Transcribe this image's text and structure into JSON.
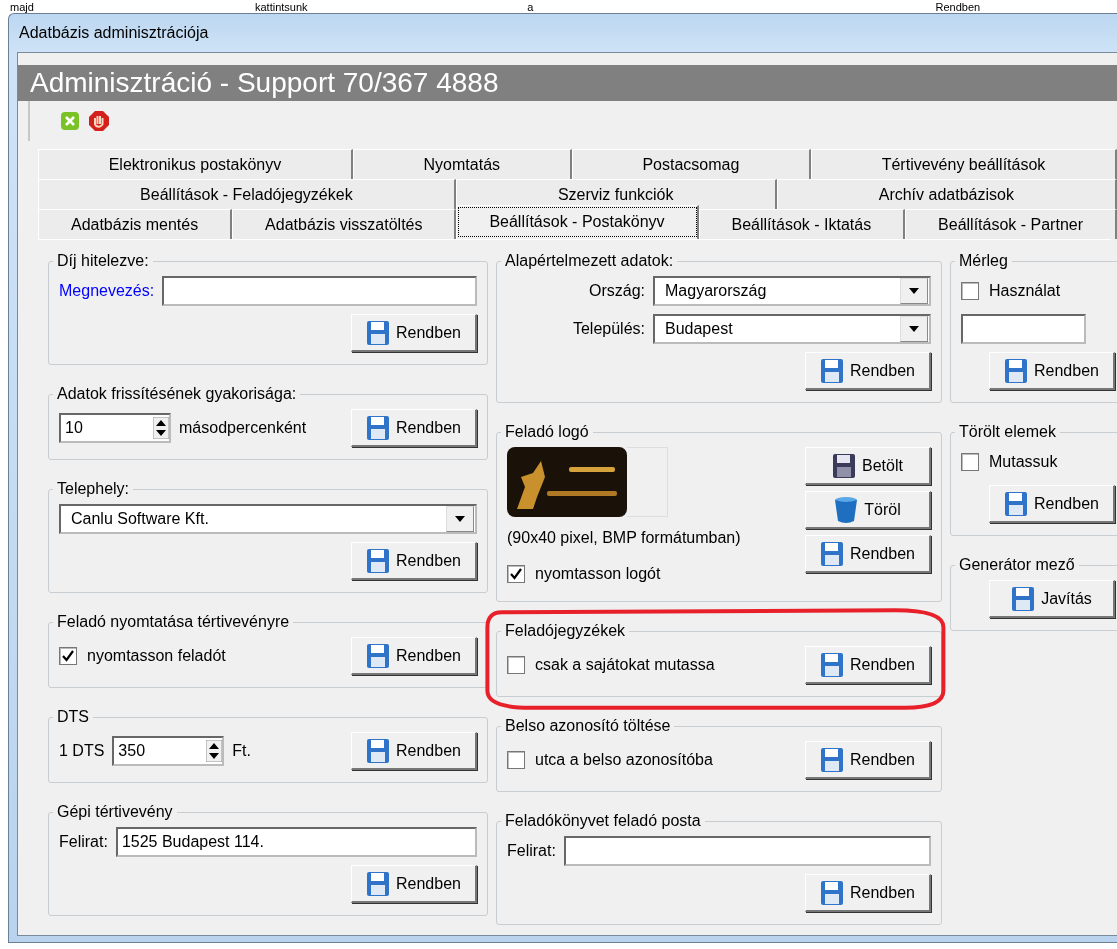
{
  "background_text": [
    "majd",
    "kattintsunk",
    "a",
    "Rendben"
  ],
  "window": {
    "title": "Adatbázis adminisztrációja"
  },
  "header": {
    "title": "Adminisztráció - Support 70/367 4888"
  },
  "toolbar": [
    {
      "kind": "ok"
    },
    {
      "kind": "stop"
    }
  ],
  "tab_rows": [
    [
      {
        "label": "Elektronikus postakönyv",
        "selected": false
      },
      {
        "label": "Nyomtatás",
        "selected": false
      },
      {
        "label": "Postacsomag",
        "selected": false
      },
      {
        "label": "Tértivevény beállítások",
        "selected": false
      }
    ],
    [
      {
        "label": "Beállítások - Feladójegyzékek",
        "selected": false
      },
      {
        "label": "Szerviz funkciók",
        "selected": false
      },
      {
        "label": "Archív adatbázisok",
        "selected": false
      }
    ],
    [
      {
        "label": "Adatbázis mentés",
        "selected": false
      },
      {
        "label": "Adatbázis visszatöltés",
        "selected": false
      },
      {
        "label": "Beállítások - Postakönyv",
        "selected": true
      },
      {
        "label": "Beállítások - Iktatás",
        "selected": false
      },
      {
        "label": "Beállítások - Partner",
        "selected": false
      }
    ]
  ],
  "columns": [
    {
      "groups": [
        {
          "title": "Díj hitelezve:",
          "kind": "stack",
          "lines": [
            [
              {
                "kind": "field",
                "label": "Megnevezés:",
                "accent": true
              }
            ],
            [
              {
                "kind": "button",
                "label": "Rendben"
              }
            ]
          ]
        },
        {
          "title": "Adatok frissítésének gyakorisága:",
          "kind": "stack",
          "lines": [
            [
              {
                "kind": "spin",
                "value": "10",
                "suffix": "másodpercenként"
              },
              {
                "kind": "button",
                "label": "Rendben"
              }
            ]
          ]
        },
        {
          "title": "Telephely:",
          "kind": "stack",
          "lines": [
            [
              {
                "kind": "combo",
                "value": "Canlu Software Kft."
              }
            ],
            [
              {
                "kind": "button",
                "label": "Rendben"
              }
            ]
          ]
        },
        {
          "title": "Feladó nyomtatása tértivevényre",
          "kind": "stack",
          "lines": [
            [
              {
                "kind": "checkbox",
                "label": "nyomtasson feladót",
                "checked": true
              },
              {
                "kind": "button",
                "label": "Rendben"
              }
            ]
          ]
        },
        {
          "title": "DTS",
          "kind": "stack",
          "lines": [
            [
              {
                "kind": "spin",
                "prefix": "1 DTS",
                "value": "350",
                "suffix": "Ft."
              },
              {
                "kind": "button",
                "label": "Rendben"
              }
            ]
          ]
        },
        {
          "title": "Gépi tértivevény",
          "kind": "stack",
          "lines": [
            [
              {
                "kind": "field",
                "label": "Felirat:",
                "value": "1525 Budapest 114."
              }
            ],
            [
              {
                "kind": "button",
                "label": "Rendben"
              }
            ]
          ]
        }
      ]
    },
    {
      "groups": [
        {
          "title": "Alapértelmezett adatok:",
          "kind": "stack",
          "lines": [
            [
              {
                "kind": "combo",
                "label": "Ország:",
                "value": "Magyarország"
              }
            ],
            [
              {
                "kind": "combo",
                "label": "Település:",
                "value": "Budapest"
              }
            ],
            [
              {
                "kind": "button",
                "label": "Rendben"
              }
            ]
          ]
        },
        {
          "title": "Feladó logó",
          "kind": "split",
          "left": [
            [
              {
                "kind": "picture"
              }
            ],
            [
              {
                "kind": "note",
                "text": "(90x40 pixel, BMP formátumban)"
              }
            ],
            [
              {
                "kind": "checkbox",
                "label": "nyomtasson logót",
                "checked": true
              }
            ]
          ],
          "right": [
            [
              {
                "kind": "load_button",
                "label": "Betölt"
              }
            ],
            [
              {
                "kind": "delete_button",
                "label": "Töröl"
              }
            ],
            [
              {
                "kind": "button",
                "label": "Rendben"
              }
            ]
          ]
        },
        {
          "title": "Feladójegyzékek",
          "kind": "stack",
          "highlighted": true,
          "lines": [
            [
              {
                "kind": "checkbox",
                "label": "csak a sajátokat mutassa",
                "checked": false
              },
              {
                "kind": "button",
                "label": "Rendben"
              }
            ]
          ]
        },
        {
          "title": "Belso azonosító töltése",
          "kind": "stack",
          "lines": [
            [
              {
                "kind": "checkbox",
                "label": "utca a belso azonosítóba",
                "checked": false
              },
              {
                "kind": "button",
                "label": "Rendben"
              }
            ]
          ]
        },
        {
          "title": "Feladókönyvet feladó posta",
          "kind": "stack",
          "lines": [
            [
              {
                "kind": "field",
                "label": "Felirat:"
              }
            ],
            [
              {
                "kind": "button",
                "label": "Rendben"
              }
            ]
          ]
        }
      ]
    },
    {
      "groups": [
        {
          "title": "Mérleg",
          "kind": "stack",
          "lines": [
            [
              {
                "kind": "checkbox",
                "label": "Használat",
                "checked": false
              }
            ],
            [
              {
                "kind": "field"
              }
            ],
            [
              {
                "kind": "button",
                "label": "Rendben"
              }
            ]
          ]
        },
        {
          "title": "Törölt elemek",
          "kind": "stack",
          "lines": [
            [
              {
                "kind": "checkbox",
                "label": "Mutassuk",
                "checked": false
              }
            ],
            [
              {
                "kind": "button",
                "label": "Rendben"
              }
            ]
          ]
        },
        {
          "title": "Generátor mező",
          "kind": "stack",
          "lines": [
            [
              {
                "kind": "button",
                "label": "Javítás"
              }
            ]
          ]
        }
      ]
    }
  ]
}
